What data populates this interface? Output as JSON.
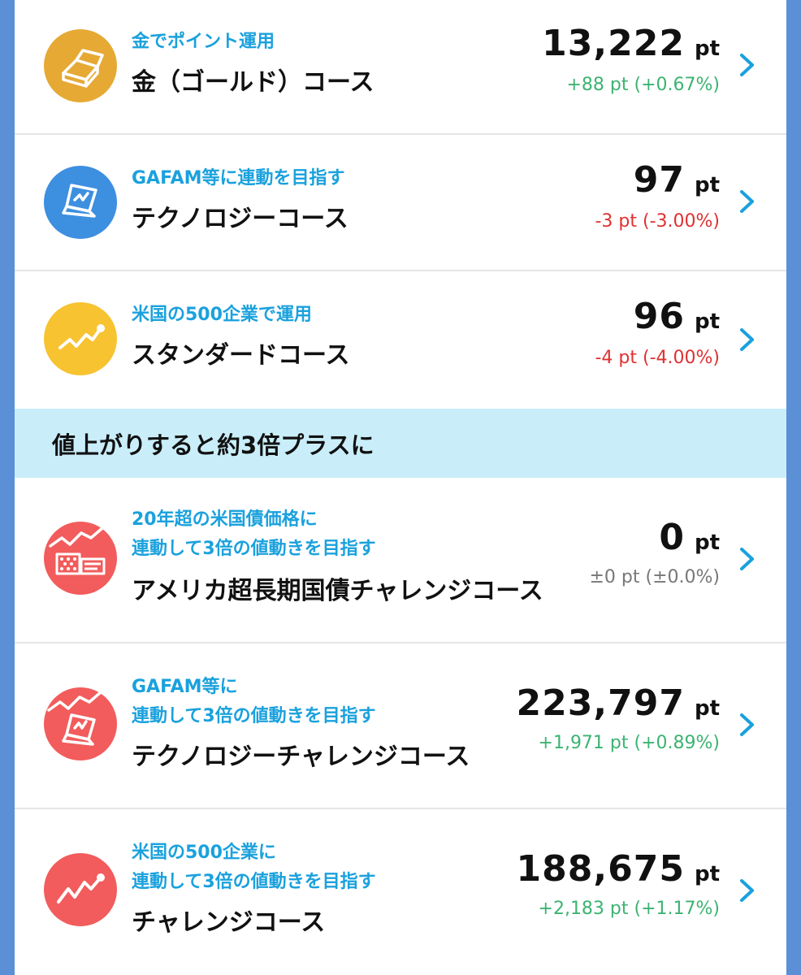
{
  "courses": [
    {
      "subtitle_lines": [
        "金でポイント運用"
      ],
      "name": "金（ゴールド）コース",
      "points": "13,222",
      "unit": "pt",
      "change": "+88 pt (+0.67%)",
      "change_color": "#3cb371",
      "icon": "gold-bar-icon",
      "icon_color": "#e6a934"
    },
    {
      "subtitle_lines": [
        "GAFAM等に連動を目指す"
      ],
      "name": "テクノロジーコース",
      "points": "97",
      "unit": "pt",
      "change": "-3 pt (-3.00%)",
      "change_color": "#e03131",
      "icon": "laptop-icon",
      "icon_color": "#3d8fe0"
    },
    {
      "subtitle_lines": [
        "米国の500企業で運用"
      ],
      "name": "スタンダードコース",
      "points": "96",
      "unit": "pt",
      "change": "-4 pt (-4.00%)",
      "change_color": "#e03131",
      "icon": "trend-line-icon",
      "icon_color": "#f7c331"
    },
    {
      "subtitle_lines": [
        "20年超の米国債価格に",
        "連動して3倍の値動きを目指す"
      ],
      "name": "アメリカ超長期国債チャレンジコース",
      "points": "0",
      "unit": "pt",
      "change": "±0 pt (±0.0%)",
      "change_color": "#777777",
      "icon": "us-bond-icon",
      "icon_color": "#f25c5c"
    },
    {
      "subtitle_lines": [
        "GAFAM等に",
        "連動して3倍の値動きを目指す"
      ],
      "name": "テクノロジーチャレンジコース",
      "points": "223,797",
      "unit": "pt",
      "change": "+1,971 pt (+0.89%)",
      "change_color": "#3cb371",
      "icon": "laptop-trend-icon",
      "icon_color": "#f25c5c"
    },
    {
      "subtitle_lines": [
        "米国の500企業に",
        "連動して3倍の値動きを目指す"
      ],
      "name": "チャレンジコース",
      "points": "188,675",
      "unit": "pt",
      "change": "+2,183 pt (+1.17%)",
      "change_color": "#3cb371",
      "icon": "trend-line-icon",
      "icon_color": "#f25c5c"
    }
  ],
  "banner": {
    "text": "値上がりすると約3倍プラスに"
  },
  "colors": {
    "subtitle": "#1aa1dd",
    "chevron": "#1aa1dd",
    "banner_bg": "#c9eefa",
    "outer_bg": "#5b8fd6"
  }
}
